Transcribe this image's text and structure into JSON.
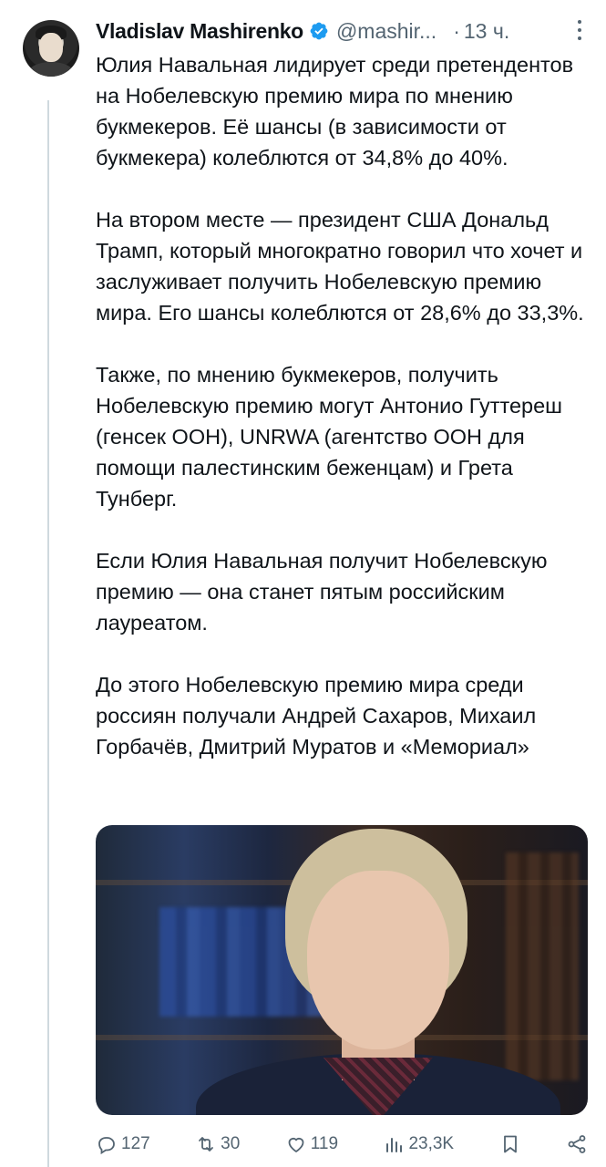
{
  "author": {
    "name": "Vladislav Mashirenko",
    "handle": "@mashir...",
    "separator": "·",
    "time": "13 ч."
  },
  "tweet": {
    "paragraphs": [
      "Юлия Навальная лидирует среди претендентов на Нобелевскую премию мира по мнению букмекеров. Её шансы (в зависимости от букмекера) колеблются от 34,8% до 40%.",
      "На втором месте — президент США Дональд Трамп, который многократно говорил что хочет и заслуживает получить Нобелевскую премию мира. Его шансы колеблются от 28,6% до 33,3%.",
      "Также, по мнению букмекеров, получить Нобелевскую премию могут Антонио Гуттереш (генсек ООН), UNRWA (агентство ООН для помощи палестинским беженцам) и Грета Тунберг.",
      "Если Юлия Навальная получит Нобелевскую премию — она станет пятым российским лауреатом.",
      "До этого Нобелевскую премию мира среди россиян получали Андрей Сахаров, Михаил Горбачёв, Дмитрий Муратов и «Мемориал»"
    ]
  },
  "actions": {
    "replies": "127",
    "reposts": "30",
    "likes": "119",
    "views": "23,3K"
  },
  "colors": {
    "verified": "#1d9bf0",
    "secondary_text": "#536471",
    "primary_text": "#0f1419"
  }
}
